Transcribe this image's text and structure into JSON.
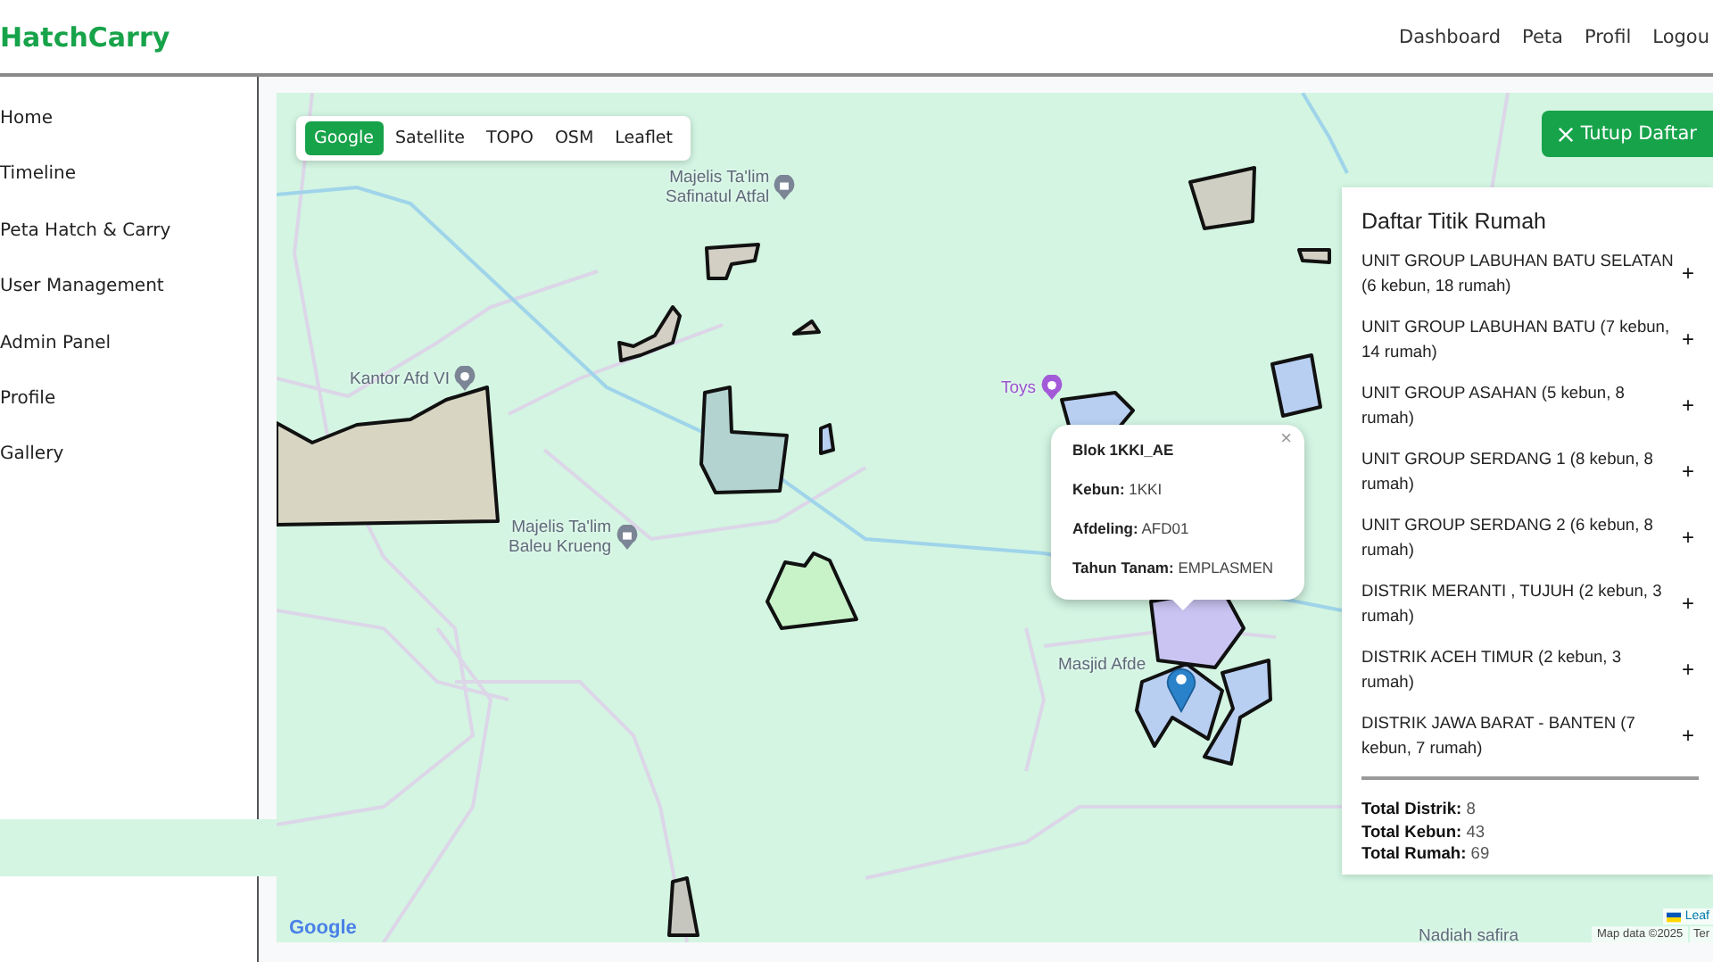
{
  "header": {
    "logo": "HatchCarry",
    "nav": [
      {
        "label": "Dashboard"
      },
      {
        "label": "Peta"
      },
      {
        "label": "Profil"
      },
      {
        "label": "Logou"
      }
    ]
  },
  "sidebar": {
    "items": [
      {
        "label": "Home"
      },
      {
        "label": "Timeline"
      },
      {
        "label": "Peta Hatch & Carry"
      },
      {
        "label": "User Management"
      },
      {
        "label": "Admin Panel"
      },
      {
        "label": "Profile"
      },
      {
        "label": "Gallery"
      }
    ]
  },
  "map": {
    "layers": [
      {
        "label": "Google",
        "selected": true
      },
      {
        "label": "Satellite",
        "selected": false
      },
      {
        "label": "TOPO",
        "selected": false
      },
      {
        "label": "OSM",
        "selected": false
      },
      {
        "label": "Leaflet",
        "selected": false
      }
    ],
    "toggle_button": "Tutup Daftar",
    "labels": [
      {
        "text": "Majelis Ta'lim\nSafinatul Atfal",
        "kind": "mosque"
      },
      {
        "text": "Kantor Afd VI",
        "kind": "place"
      },
      {
        "text": "Majelis Ta'lim\nBaleu Krueng",
        "kind": "mosque"
      },
      {
        "text": "Toys",
        "kind": "shop"
      },
      {
        "text": "Masjid Afde",
        "kind": "plain"
      },
      {
        "text": "Nadiah safira",
        "kind": "plain"
      }
    ],
    "popup": {
      "title": "Blok 1KKI_AE",
      "close": "×",
      "fields": [
        {
          "label": "Kebun:",
          "value": "1KKI"
        },
        {
          "label": "Afdeling:",
          "value": "AFD01"
        },
        {
          "label": "Tahun Tanam:",
          "value": "EMPLASMEN"
        }
      ]
    },
    "panel": {
      "title": "Daftar Titik Rumah",
      "groups": [
        {
          "label": "UNIT GROUP LABUHAN BATU SELATAN (6 kebun, 18 rumah)",
          "toggle": "+"
        },
        {
          "label": "UNIT GROUP LABUHAN BATU (7 kebun, 14 rumah)",
          "toggle": "+"
        },
        {
          "label": "UNIT GROUP ASAHAN (5 kebun, 8 rumah)",
          "toggle": "+"
        },
        {
          "label": "UNIT GROUP SERDANG 1 (8 kebun, 8 rumah)",
          "toggle": "+"
        },
        {
          "label": "UNIT GROUP SERDANG 2 (6 kebun, 8 rumah)",
          "toggle": "+"
        },
        {
          "label": "DISTRIK MERANTI , TUJUH (2 kebun, 3 rumah)",
          "toggle": "+"
        },
        {
          "label": "DISTRIK ACEH TIMUR (2 kebun, 3 rumah)",
          "toggle": "+"
        },
        {
          "label": "DISTRIK JAWA BARAT - BANTEN (7 kebun, 7 rumah)",
          "toggle": "+"
        }
      ],
      "totals": [
        {
          "label": "Total Distrik:",
          "value": "8"
        },
        {
          "label": "Total Kebun:",
          "value": "43"
        },
        {
          "label": "Total Rumah:",
          "value": "69"
        }
      ]
    },
    "attribution": {
      "google": "Google",
      "map_data": "Map data ©2025",
      "terms": "Ter",
      "leaflet": "Leaf"
    }
  }
}
